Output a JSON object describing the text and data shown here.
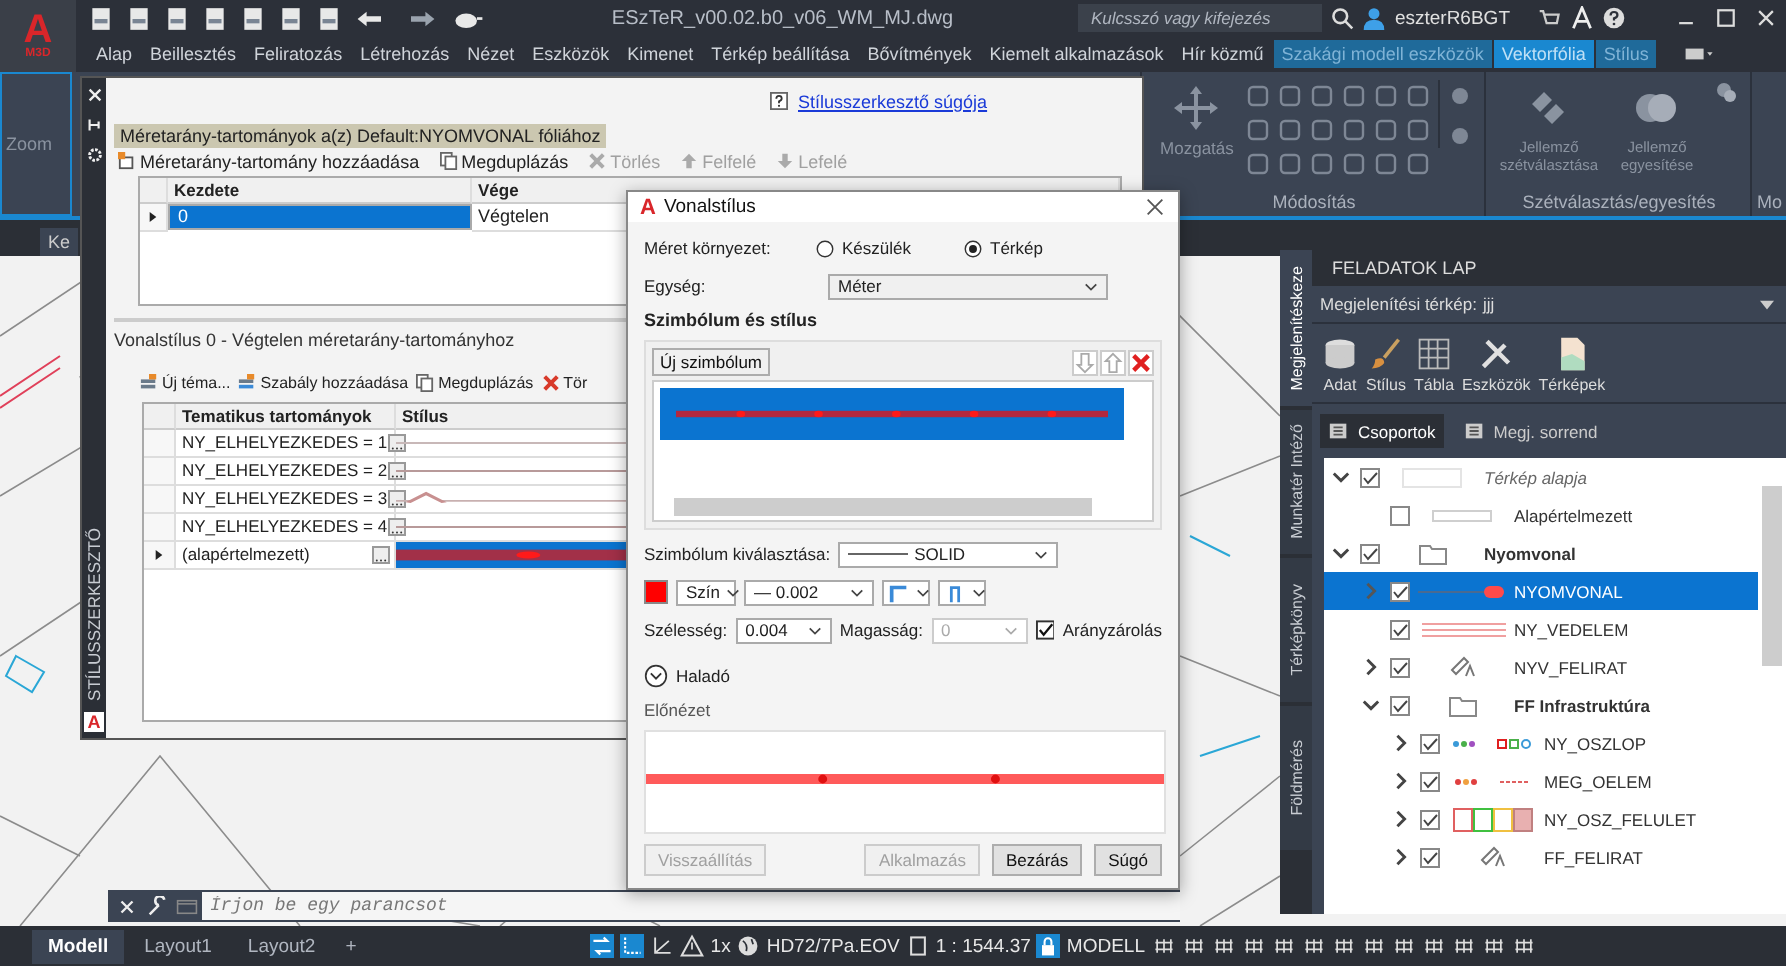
{
  "app": {
    "logo_letter": "A",
    "logo_caption": "M3D",
    "title": "ESzTeR_v00.02.b0_v06_WM_MJ.dwg",
    "search": {
      "placeholder": "Kulcsszó vagy kifejezés"
    },
    "user": "eszterR6BGT"
  },
  "ribbon_tabs": [
    {
      "label": "Alap",
      "kind": "plain",
      "selected": false
    },
    {
      "label": "Beillesztés",
      "kind": "plain",
      "selected": false
    },
    {
      "label": "Feliratozás",
      "kind": "plain",
      "selected": false
    },
    {
      "label": "Létrehozás",
      "kind": "plain",
      "selected": false
    },
    {
      "label": "Nézet",
      "kind": "plain",
      "selected": false
    },
    {
      "label": "Eszközök",
      "kind": "plain",
      "selected": false
    },
    {
      "label": "Kimenet",
      "kind": "plain",
      "selected": false
    },
    {
      "label": "Térkép beállítása",
      "kind": "plain",
      "selected": false
    },
    {
      "label": "Bővítmények",
      "kind": "plain",
      "selected": false
    },
    {
      "label": "Kiemelt alkalmazások",
      "kind": "plain",
      "selected": false
    },
    {
      "label": "Hír közmű",
      "kind": "plain",
      "selected": false
    },
    {
      "label": "Szakági modell eszközök",
      "kind": "context",
      "selected": false
    },
    {
      "label": "Vektorfólia",
      "kind": "context",
      "selected": true
    },
    {
      "label": "Stílus",
      "kind": "context",
      "selected": false
    }
  ],
  "ribbon": {
    "zoom_label": "Zoom",
    "modify_group": {
      "title": "Módosítás",
      "button": "Mozgatás"
    },
    "split_group": {
      "title": "Szétválasztás/egyesítés",
      "buttons": [
        "Jellemző szétválasztása",
        "Jellemző egyesítése"
      ]
    },
    "next_group_title": "Mo"
  },
  "doc_tab": "Ke",
  "style_editor": {
    "side_title": "STÍLUSSZERKESZTŐ",
    "logo_letter": "A",
    "help_link": "Stílusszerkesztő súgója",
    "ranges_caption": "Méretarány-tartományok a(z) Default:NYOMVONAL fóliához",
    "ranges_toolbar": [
      {
        "label": "Méretarány-tartomány hozzáadása",
        "kind": "add",
        "disabled": false
      },
      {
        "label": "Megduplázás",
        "kind": "copy",
        "disabled": false
      },
      {
        "label": "Törlés",
        "kind": "delete",
        "disabled": true
      },
      {
        "label": "Felfelé",
        "kind": "up",
        "disabled": true
      },
      {
        "label": "Lefelé",
        "kind": "down",
        "disabled": true
      }
    ],
    "ranges_table": {
      "columns": [
        "Kezdete",
        "Vége"
      ],
      "rows": [
        {
          "cells": [
            "0",
            "Végtelen"
          ],
          "selected": true
        }
      ]
    },
    "style_caption": "Vonalstílus 0 - Végtelen méretarány-tartományhoz",
    "rules_toolbar": [
      {
        "label": "Új téma...",
        "kind": "theme",
        "disabled": false
      },
      {
        "label": "Szabály hozzáadása",
        "kind": "rule",
        "disabled": false
      },
      {
        "label": "Megduplázás",
        "kind": "copy",
        "disabled": false
      },
      {
        "label": "Tör",
        "kind": "delete",
        "disabled": false
      }
    ],
    "rules_table": {
      "columns": [
        "Tematikus tartományok",
        "Stílus"
      ],
      "rows": [
        {
          "label": "NY_ELHELYEZKEDES = 1",
          "kind": "plain",
          "selected": false
        },
        {
          "label": "NY_ELHELYEZKEDES = 2",
          "kind": "dashed",
          "selected": false
        },
        {
          "label": "NY_ELHELYEZKEDES = 3",
          "kind": "triangles",
          "selected": false
        },
        {
          "label": "NY_ELHELYEZKEDES = 4",
          "kind": "ticks",
          "selected": false
        },
        {
          "label": "(alapértelmezett)",
          "kind": "dotted",
          "selected": true
        }
      ]
    }
  },
  "dialog": {
    "logo_letter": "A",
    "title": "Vonalstílus",
    "size_context": {
      "label": "Méret környezet:",
      "options": [
        {
          "label": "Készülék",
          "selected": false
        },
        {
          "label": "Térkép",
          "selected": true
        }
      ]
    },
    "unit": {
      "label": "Egység:",
      "value": "Méter"
    },
    "section_title": "Szimbólum és stílus",
    "new_symbol_button": "Új szimbólum",
    "symbols": [
      {
        "selected": true
      }
    ],
    "symbol_select": {
      "label": "Szimbólum kiválasztása:",
      "value": "SOLID"
    },
    "color_button": {
      "label": "Szín",
      "color": "#ff0000"
    },
    "lineweight": {
      "value": "— 0.002"
    },
    "width": {
      "label": "Szélesség:",
      "value": "0.004"
    },
    "height": {
      "label": "Magasság:",
      "value": "0",
      "disabled": true
    },
    "aspect_lock": {
      "label": "Arányzárolás",
      "checked": true
    },
    "advanced": {
      "label": "Haladó",
      "expanded": false
    },
    "preview_label": "Előnézet",
    "buttons": [
      {
        "label": "Visszaállítás",
        "disabled": true
      },
      {
        "label": "Alkalmazás",
        "disabled": true
      },
      {
        "label": "Bezárás",
        "disabled": false
      },
      {
        "label": "Súgó",
        "disabled": false
      }
    ]
  },
  "task_pane": {
    "title": "FELADATOK LAP",
    "side_tabs": [
      {
        "label": "Megjelenítéskeze",
        "selected": true
      },
      {
        "label": "Munkatér Intéző",
        "selected": false
      },
      {
        "label": "Térképkönyv",
        "selected": false
      },
      {
        "label": "Földmérés",
        "selected": false
      }
    ],
    "map_select": {
      "label": "Megjelenítési térkép:",
      "value": "jjj"
    },
    "tools": [
      {
        "label": "Adat",
        "kind": "data"
      },
      {
        "label": "Stílus",
        "kind": "brush"
      },
      {
        "label": "Tábla",
        "kind": "table"
      },
      {
        "label": "Eszközök",
        "kind": "tools"
      },
      {
        "label": "Térképek",
        "kind": "maps"
      }
    ],
    "view_buttons": [
      {
        "label": "Csoportok",
        "selected": true
      },
      {
        "label": "Megj. sorrend",
        "selected": false
      }
    ],
    "tree": [
      {
        "label": "Térkép alapja",
        "kind": "base",
        "expanded": true,
        "checked": true,
        "selected": false,
        "children": [
          {
            "label": "Alapértelmezett",
            "kind": "plain-line",
            "checked": false,
            "selected": false
          }
        ]
      },
      {
        "label": "Nyomvonal",
        "kind": "group",
        "expanded": true,
        "checked": true,
        "selected": false,
        "children": [
          {
            "label": "NYOMVONAL",
            "kind": "marker-line",
            "expanded": false,
            "checked": true,
            "selected": true
          },
          {
            "label": "NY_VEDELEM",
            "kind": "double-line",
            "checked": true,
            "selected": false
          },
          {
            "label": "NYV_FELIRAT",
            "kind": "label",
            "expanded": false,
            "checked": true,
            "selected": false
          },
          {
            "label": "FF Infrastruktúra",
            "kind": "group",
            "expanded": true,
            "checked": true,
            "selected": false,
            "children": [
              {
                "label": "NY_OSZLOP",
                "kind": "points",
                "expanded": false,
                "checked": true,
                "selected": false
              },
              {
                "label": "MEG_OELEM",
                "kind": "points2",
                "expanded": false,
                "checked": true,
                "selected": false
              },
              {
                "label": "NY_OSZ_FELULET",
                "kind": "fills",
                "expanded": false,
                "checked": true,
                "selected": false
              },
              {
                "label": "FF_FELIRAT",
                "kind": "label",
                "expanded": false,
                "checked": true,
                "selected": false
              }
            ]
          }
        ]
      }
    ]
  },
  "command_line": {
    "placeholder": "Írjon be egy parancsot"
  },
  "status_bar": {
    "layout_tabs": [
      {
        "label": "Modell",
        "selected": true
      },
      {
        "label": "Layout1",
        "selected": false
      },
      {
        "label": "Layout2",
        "selected": false
      }
    ],
    "add_tab": "+",
    "annotation_scale": "1x",
    "coordinate_system": "HD72/7Pa.EOV",
    "map_scale": "1 : 1544.37",
    "space": "MODELL"
  }
}
